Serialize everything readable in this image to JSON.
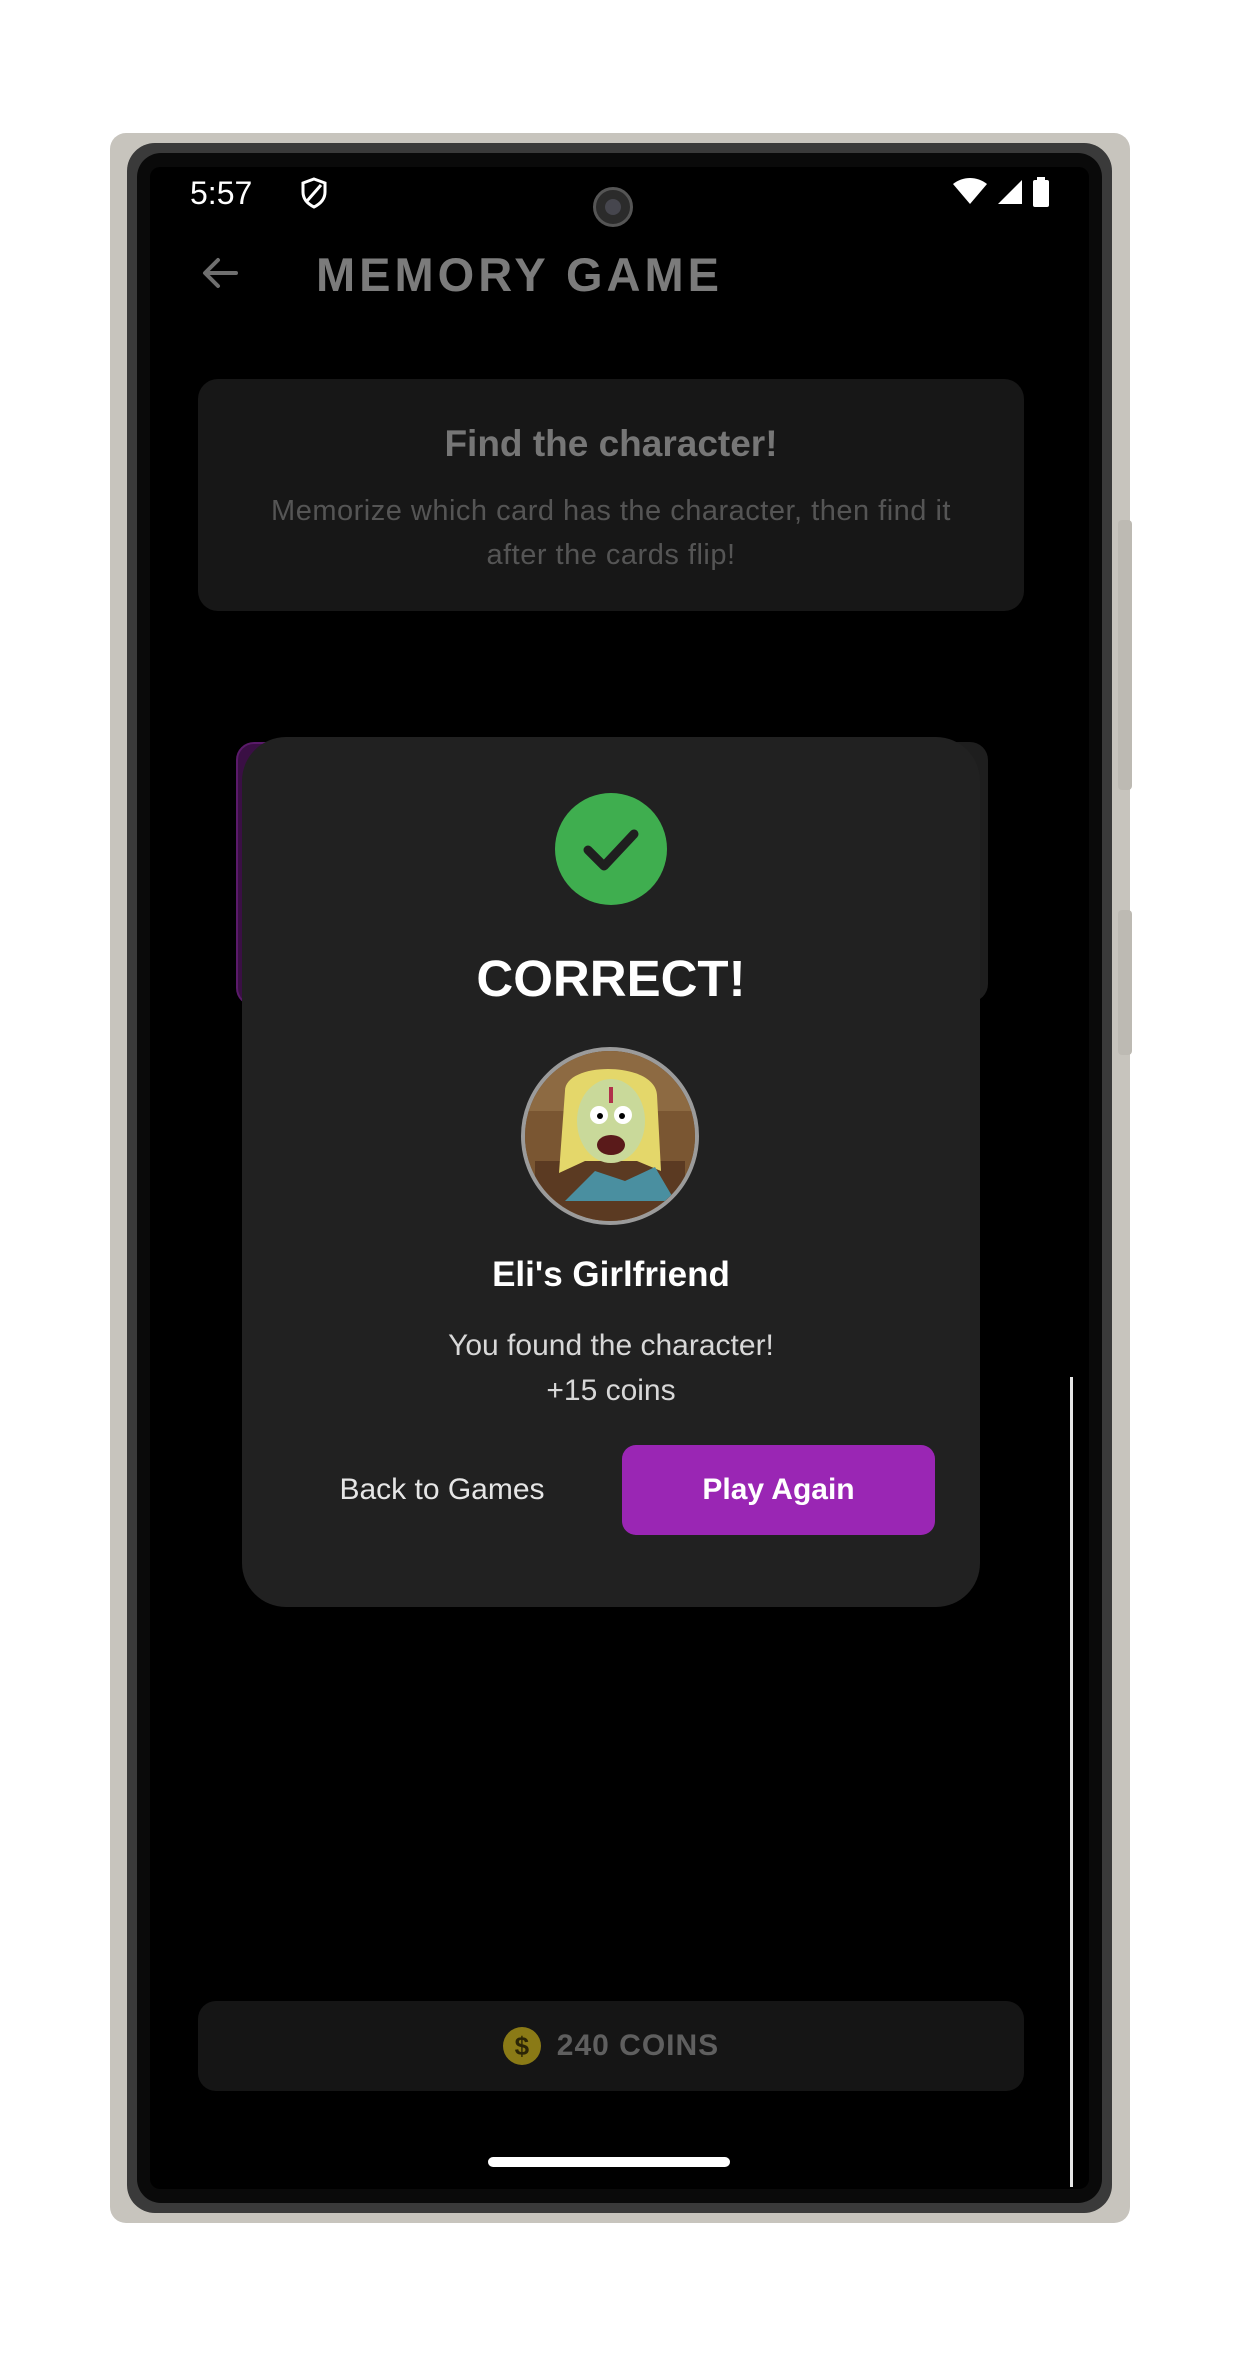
{
  "status_bar": {
    "time": "5:57",
    "icons": [
      "shield-icon",
      "wifi-icon",
      "signal-icon",
      "battery-icon"
    ]
  },
  "app_bar": {
    "title": "MEMORY GAME",
    "back_icon": "arrow-left-icon"
  },
  "info_card": {
    "title": "Find the character!",
    "text": "Memorize which card has the character, then find it after the cards flip!"
  },
  "dialog": {
    "icon": "check-circle-icon",
    "title": "CORRECT!",
    "character_name": "Eli's Girlfriend",
    "message_line1": "You found the character!",
    "message_line2": "+15 coins",
    "back_label": "Back to Games",
    "play_label": "Play Again"
  },
  "coins_bar": {
    "icon": "dollar-coin-icon",
    "label": "240 COINS"
  },
  "colors": {
    "accent": "#9a26b4",
    "success": "#3fae4f",
    "coin": "#8a7a16",
    "background": "#000000",
    "dialog": "#212121"
  }
}
